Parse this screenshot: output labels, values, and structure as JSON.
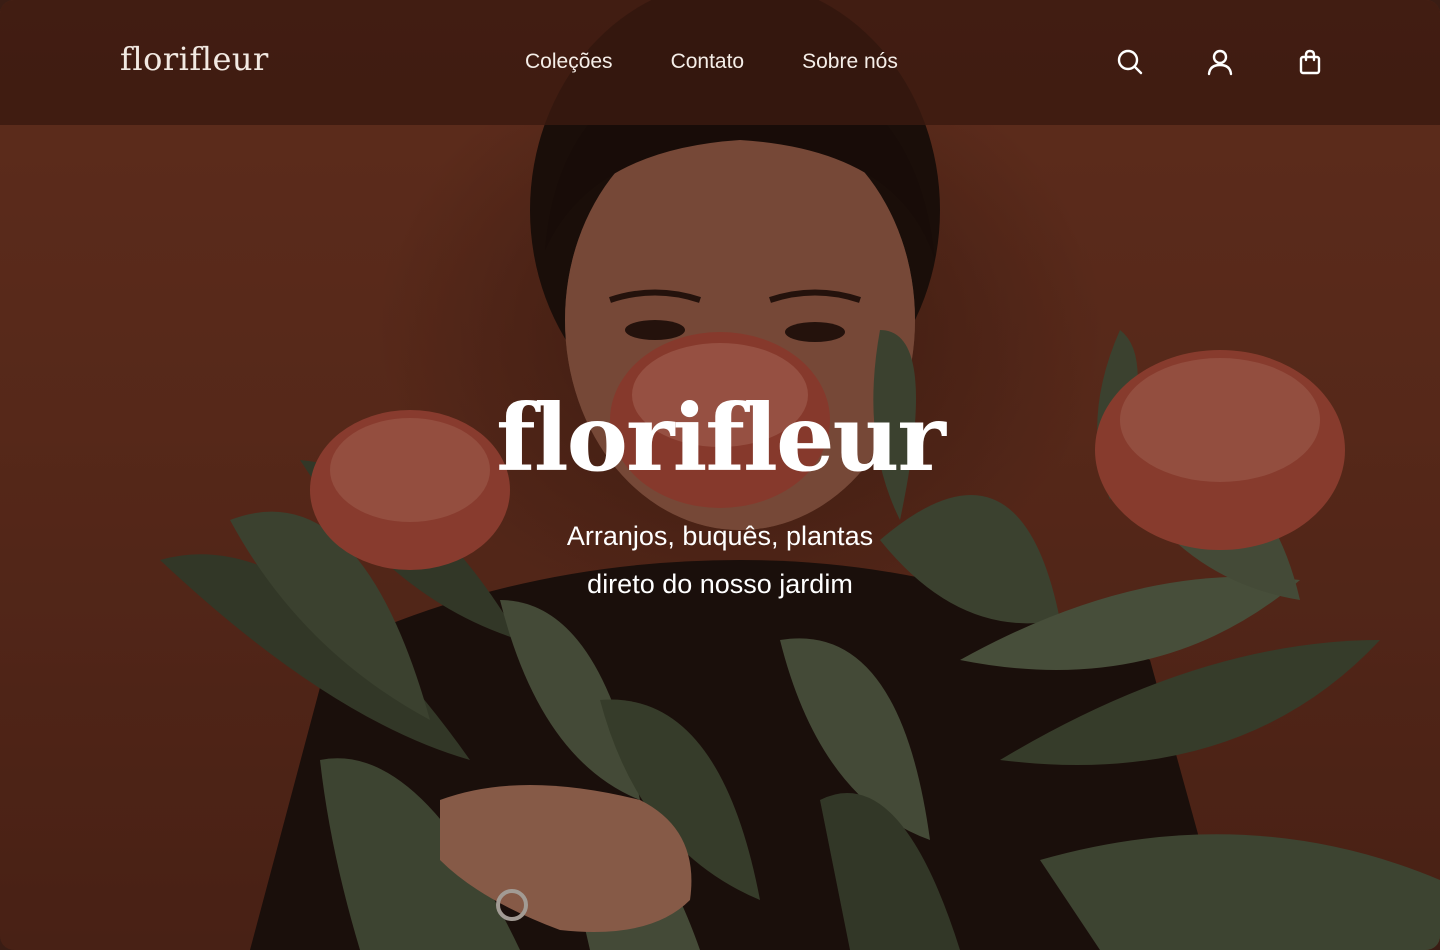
{
  "brand": {
    "logo_text": "florifleur"
  },
  "nav": {
    "items": [
      {
        "label": "Coleções"
      },
      {
        "label": "Contato"
      },
      {
        "label": "Sobre nós"
      }
    ]
  },
  "header_icons": [
    {
      "name": "search-icon"
    },
    {
      "name": "user-icon"
    },
    {
      "name": "shopping-bag-icon"
    }
  ],
  "hero": {
    "title": "florifleur",
    "subtitle_line1": "Arranjos, buquês, plantas",
    "subtitle_line2": "direto do nosso jardim",
    "image": "woman-with-protea-bouquet"
  },
  "colors": {
    "background": "#6f3522",
    "header": "#3a1a10",
    "text": "#ffffff"
  }
}
